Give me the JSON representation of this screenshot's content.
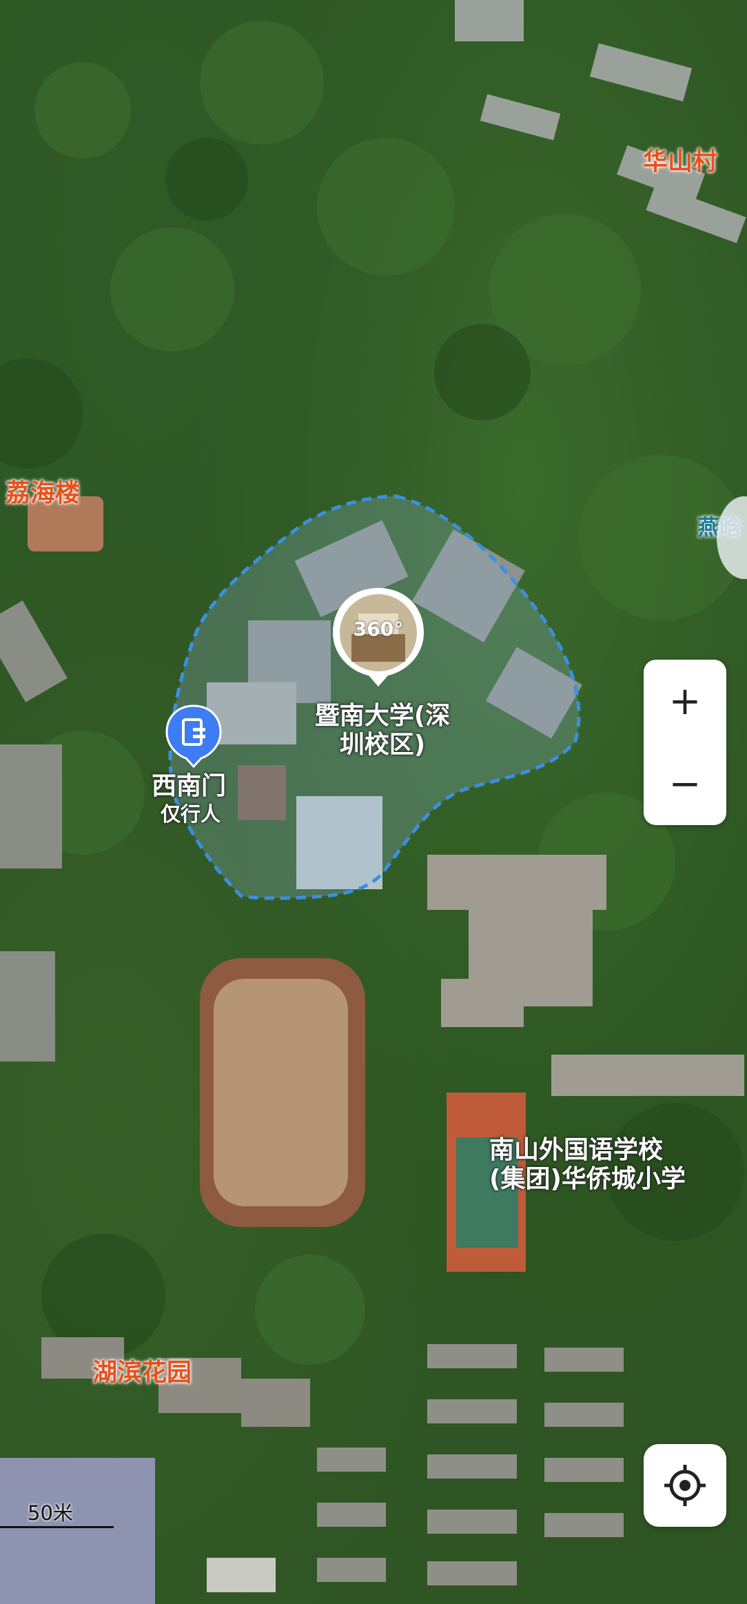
{
  "labels": {
    "huashancun": "华山村",
    "lihailou": "荔海楼",
    "yan": "燕晗",
    "jinan": "暨南大学(深圳校区)",
    "jinan_line1": "暨南大学(深",
    "jinan_line2": "圳校区)",
    "xinanmen": "西南门",
    "xinanmen_sub": "仅行人",
    "school_line1": "南山外国语学校",
    "school_line2": "(集团)华侨城小学",
    "hubin": "湖滨花园"
  },
  "controls": {
    "zoom_in": "+",
    "zoom_out": "−"
  },
  "scale": {
    "label": "50米"
  },
  "badge": {
    "text": "360°"
  },
  "colors": {
    "boundary": "#3b8fe3",
    "label_orange": "#e8501b",
    "pin_blue": "#3d7cf2"
  }
}
